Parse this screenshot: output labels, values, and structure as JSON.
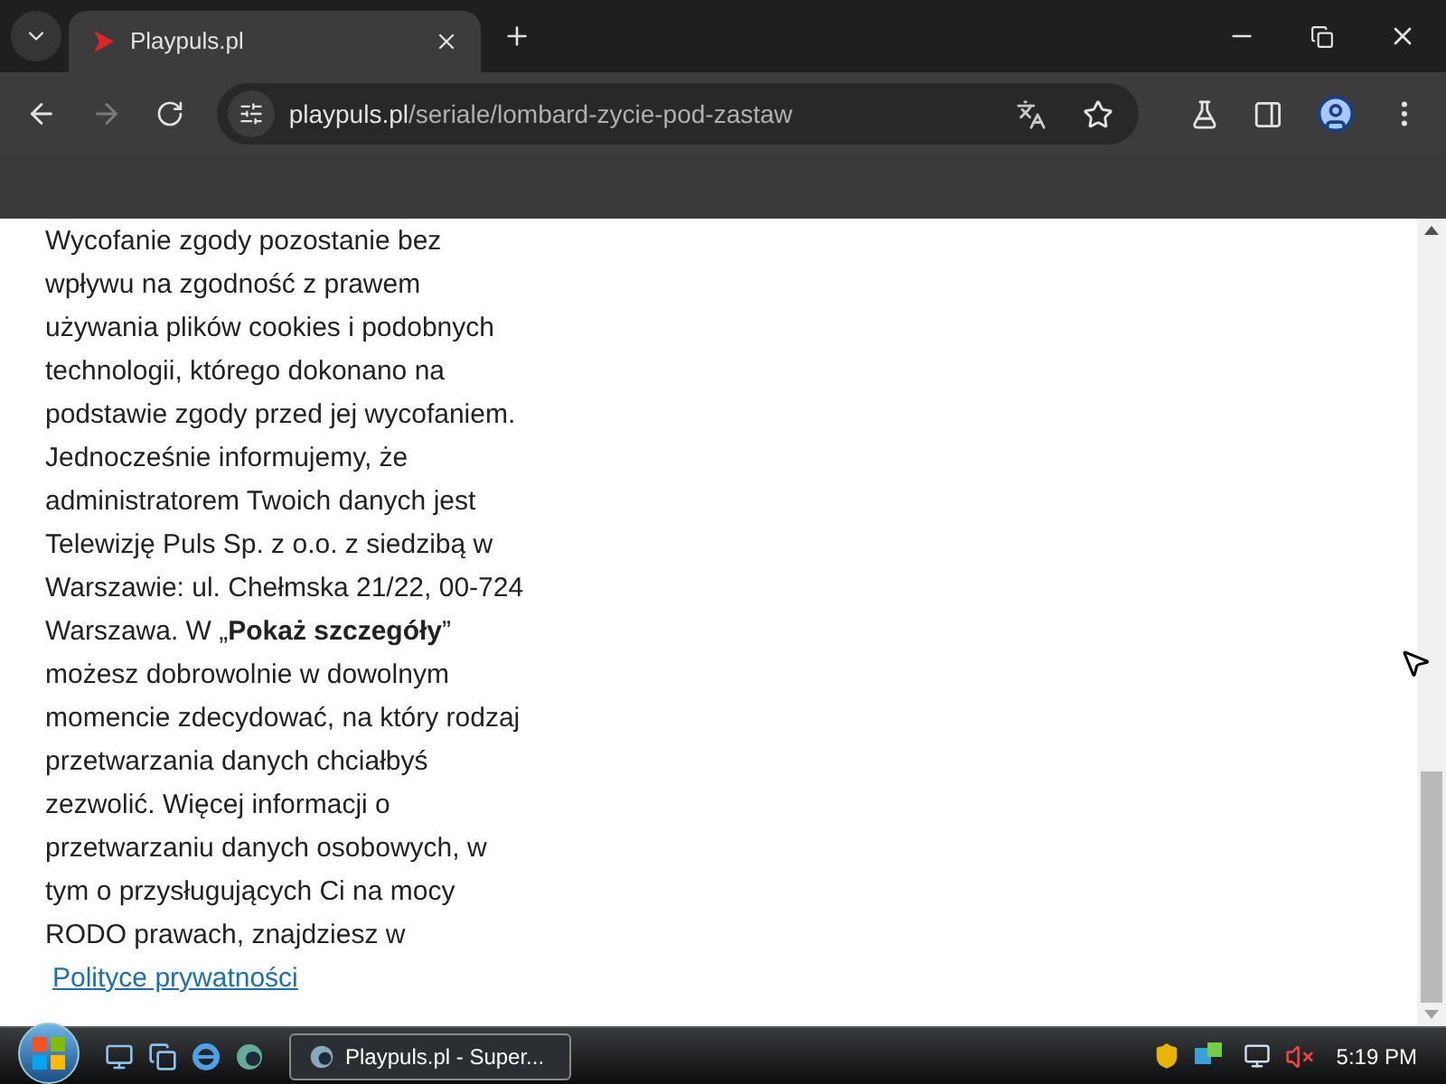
{
  "browser": {
    "tab": {
      "title": "Playpuls.pl",
      "selected": true
    },
    "address": {
      "domain": "playpuls.pl",
      "path": "/seriale/lombard-zycie-pod-zastaw"
    }
  },
  "page": {
    "paragraph": "Wycofanie zgody pozostanie bez wpływu na zgodność z prawem używania plików cookies i podobnych technologii, którego dokonano na podstawie zgody przed jej wycofaniem. Jednocześnie informujemy, że administratorem Twoich danych jest Telewizję Puls Sp. z o.o. z siedzibą w Warszawie: ul. Chełmska 21/22, 00-724 Warszawa. W „**Pokaż szczegóły**” możesz dobrowolnie w dowolnym momencie zdecydować, na który rodzaj przetwarzania danych chciałbyś zezwolić. Więcej informacji o przetwarzaniu danych osobowych, w tym o przysługujących Ci na mocy RODO prawach, znajdziesz w",
    "link": "Polityce prywatności"
  },
  "taskbar": {
    "window": {
      "label": "Playpuls.pl - Super...",
      "selected": true
    },
    "clock": "5:19 PM"
  }
}
